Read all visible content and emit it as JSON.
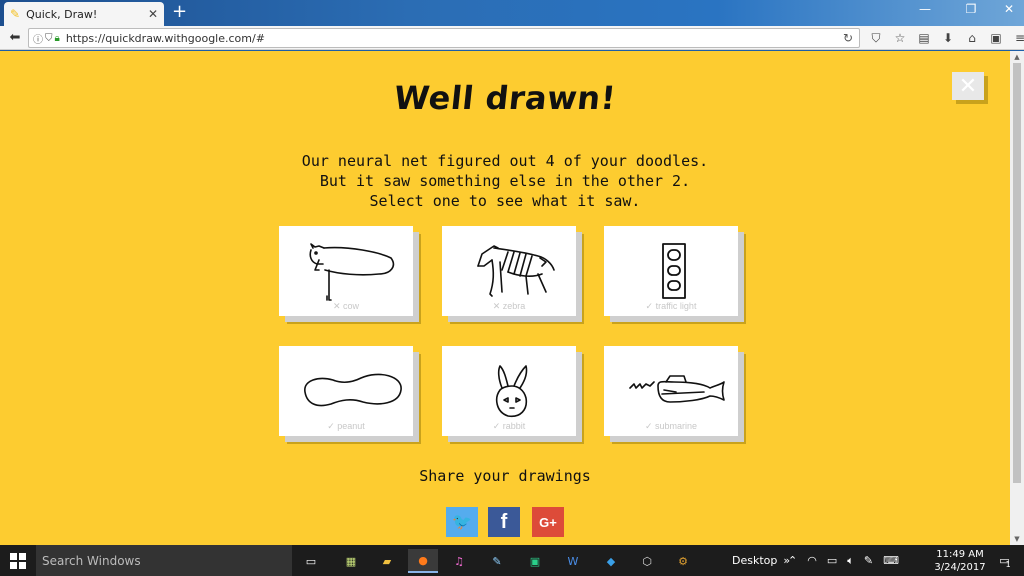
{
  "browser": {
    "tab_title": "Quick, Draw!",
    "tab_close": "✕",
    "new_tab": "+",
    "url": "https://quickdraw.withgoogle.com/#",
    "window_controls": [
      "—",
      "❐",
      "✕"
    ]
  },
  "page": {
    "heading": "Well drawn!",
    "close_symbol": "✕",
    "intro_lines": [
      "Our neural net figured out 4 of your doodles.",
      "But it saw something else in the other 2.",
      "Select one to see what it saw."
    ],
    "doodles": [
      {
        "label": "✕ cow",
        "recognized": false,
        "icon": "cow-doodle"
      },
      {
        "label": "✕ zebra",
        "recognized": false,
        "icon": "zebra-doodle"
      },
      {
        "label": "✓ traffic light",
        "recognized": true,
        "icon": "traffic-light-doodle"
      },
      {
        "label": "✓ peanut",
        "recognized": true,
        "icon": "peanut-doodle"
      },
      {
        "label": "✓ rabbit",
        "recognized": true,
        "icon": "rabbit-doodle"
      },
      {
        "label": "✓ submarine",
        "recognized": true,
        "icon": "submarine-doodle"
      }
    ],
    "share_label": "Share your drawings",
    "social": [
      {
        "name": "twitter",
        "glyph": "🐦",
        "color": "#55acee"
      },
      {
        "name": "facebook",
        "glyph": "f",
        "color": "#3b5998"
      },
      {
        "name": "google-plus",
        "glyph": "G+",
        "color": "#dd4b39"
      }
    ],
    "background_color": "#fdcc30"
  },
  "taskbar": {
    "search_placeholder": "Search Windows",
    "desktop_label": "Desktop",
    "time": "11:49 AM",
    "date": "3/24/2017",
    "notification_count": "1"
  }
}
